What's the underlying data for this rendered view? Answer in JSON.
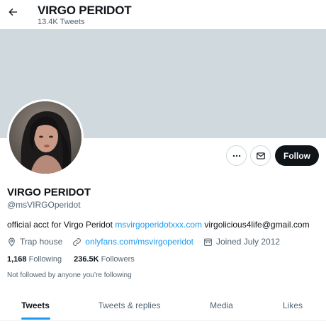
{
  "header": {
    "title": "VIRGO PERIDOT",
    "tweet_count": "13.4K Tweets",
    "back_icon": "arrow-left-icon"
  },
  "banner": {
    "color": "#cfd9de"
  },
  "actions": {
    "more_icon": "more-horizontal-icon",
    "message_icon": "envelope-icon",
    "follow_label": "Follow"
  },
  "profile": {
    "display_name": "VIRGO PERIDOT",
    "handle": "@msVIRGOperidot",
    "bio": {
      "text": "official acct for Virgo Peridot",
      "link": "msvirgoperidotxxx.com",
      "email": "virgolicious4life@gmail.com"
    },
    "location": "Trap house",
    "website": "onlyfans.com/msvirgoperidot",
    "joined": "Joined July 2012",
    "following_count": "1,168",
    "following_label": "Following",
    "followers_count": "236.5K",
    "followers_label": "Followers",
    "mutuals_note": "Not followed by anyone you’re following"
  },
  "tabs": [
    {
      "label": "Tweets",
      "active": true
    },
    {
      "label": "Tweets & replies",
      "active": false
    },
    {
      "label": "Media",
      "active": false
    },
    {
      "label": "Likes",
      "active": false
    }
  ],
  "colors": {
    "accent": "#1d9bf0",
    "text_primary": "#0f1419",
    "text_secondary": "#536471",
    "follow_button_bg": "#0f1419"
  }
}
